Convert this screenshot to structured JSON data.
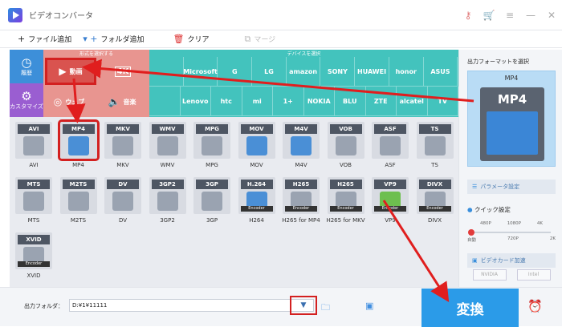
{
  "window": {
    "title": "ビデオコンバータ",
    "icons": [
      "key-icon",
      "cart-icon",
      "menu-icon",
      "minimize-icon",
      "close-icon"
    ]
  },
  "toolbar": {
    "add_file": "ファイル追加",
    "add_folder": "フォルダ追加",
    "clear": "クリア",
    "merge": "マージ"
  },
  "rail": {
    "history": "履歴",
    "customize": "カスタマイズ"
  },
  "categories": {
    "format_head": "形式を選択する",
    "device_head": "デバイスを選択",
    "video": "動画",
    "web": "ウェブ",
    "music": "音楽",
    "brands_row1": [
      "",
      "Microsoft",
      "G",
      "LG",
      "amazon",
      "SONY",
      "HUAWEI",
      "honor",
      "ASUS"
    ],
    "brands_row2": [
      "",
      "Lenovo",
      "htc",
      "mi",
      "1+",
      "NOKIA",
      "BLU",
      "ZTE",
      "alcatel",
      "TV"
    ]
  },
  "formats": [
    {
      "tag": "AVI",
      "label": "AVI",
      "kind": "gray"
    },
    {
      "tag": "MP4",
      "label": "MP4",
      "kind": "blue",
      "selected": true
    },
    {
      "tag": "MKV",
      "label": "MKV",
      "kind": "gray"
    },
    {
      "tag": "WMV",
      "label": "WMV",
      "kind": "gray"
    },
    {
      "tag": "MPG",
      "label": "MPG",
      "kind": "gray"
    },
    {
      "tag": "MOV",
      "label": "MOV",
      "kind": "blue"
    },
    {
      "tag": "M4V",
      "label": "M4V",
      "kind": "blue"
    },
    {
      "tag": "VOB",
      "label": "VOB",
      "kind": "gray"
    },
    {
      "tag": "ASF",
      "label": "ASF",
      "kind": "gray"
    },
    {
      "tag": "TS",
      "label": "TS",
      "kind": "gray"
    },
    {
      "tag": "MTS",
      "label": "MTS",
      "kind": "gray"
    },
    {
      "tag": "M2TS",
      "label": "M2TS",
      "kind": "gray"
    },
    {
      "tag": "DV",
      "label": "DV",
      "kind": "gray"
    },
    {
      "tag": "3GP2",
      "label": "3GP2",
      "kind": "gray"
    },
    {
      "tag": "3GP",
      "label": "3GP",
      "kind": "gray"
    },
    {
      "tag": "H.264",
      "label": "H264",
      "kind": "blue",
      "enc": "Encoder"
    },
    {
      "tag": "H265",
      "label": "H265 for MP4",
      "kind": "gray",
      "enc": "Encoder"
    },
    {
      "tag": "H265",
      "label": "H265 for MKV",
      "kind": "gray",
      "enc": "Encoder"
    },
    {
      "tag": "VP9",
      "label": "VP9",
      "kind": "green",
      "enc": "Encoder"
    },
    {
      "tag": "DIVX",
      "label": "DIVX",
      "kind": "gray",
      "enc": "Encoder"
    },
    {
      "tag": "XVID",
      "label": "XVID",
      "kind": "gray",
      "enc": "Encoder"
    }
  ],
  "right_panel": {
    "title": "出力フォーマットを選択",
    "format_caption": "MP4",
    "format_big": "MP4",
    "params": "パラメータ設定",
    "quick": "クイック設定",
    "quality_top": [
      "480P",
      "1080P",
      "4K"
    ],
    "quality_bottom": [
      "自動",
      "720P",
      "2K"
    ],
    "gpu_accel": "ビデオカード加速",
    "gpu_nvidia": "NVIDIA",
    "gpu_intel": "Intel"
  },
  "bottom": {
    "output_label": "出力フォルダ：",
    "output_path": "D:¥1¥11111",
    "convert": "変換"
  },
  "colors": {
    "accent": "#2b9be8",
    "highlight": "#d32020",
    "teal": "#43c3bd",
    "salmon": "#e89590"
  }
}
